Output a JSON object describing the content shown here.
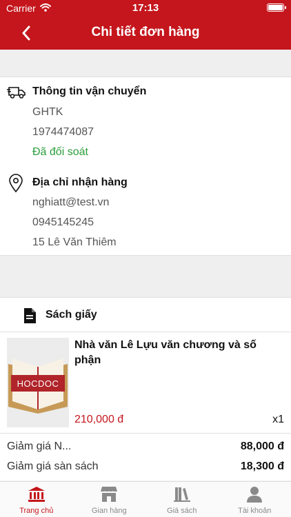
{
  "status_bar": {
    "carrier": "Carrier",
    "time": "17:13"
  },
  "nav": {
    "title": "Chi tiết đơn hàng"
  },
  "shipping": {
    "title": "Thông tin vận chuyển",
    "carrier": "GHTK",
    "tracking": "1974474087",
    "status": "Đã đối soát"
  },
  "address": {
    "title": "Địa chỉ nhận hàng",
    "email": "nghiatt@test.vn",
    "phone": "0945145245",
    "street": "15 Lê Văn Thiêm"
  },
  "section": {
    "title": "Sách giấy"
  },
  "product": {
    "title": "Nhà văn Lê Lựu văn chương và số phận",
    "cover_text": "HOCDOC",
    "price": "210,000 đ",
    "quantity": "x1"
  },
  "summary": [
    {
      "label": "Giảm giá N...",
      "value": "88,000 đ"
    },
    {
      "label": "Giảm giá sàn sách",
      "value": "18,300 đ"
    }
  ],
  "tabs": [
    {
      "label": "Trang chủ",
      "icon": "bank-icon",
      "active": true
    },
    {
      "label": "Gian hàng",
      "icon": "store-icon",
      "active": false
    },
    {
      "label": "Giá sách",
      "icon": "bookshelf-icon",
      "active": false
    },
    {
      "label": "Tài khoản",
      "icon": "user-icon",
      "active": false
    }
  ],
  "colors": {
    "brand": "#c4161c",
    "success": "#2a9d3a"
  }
}
